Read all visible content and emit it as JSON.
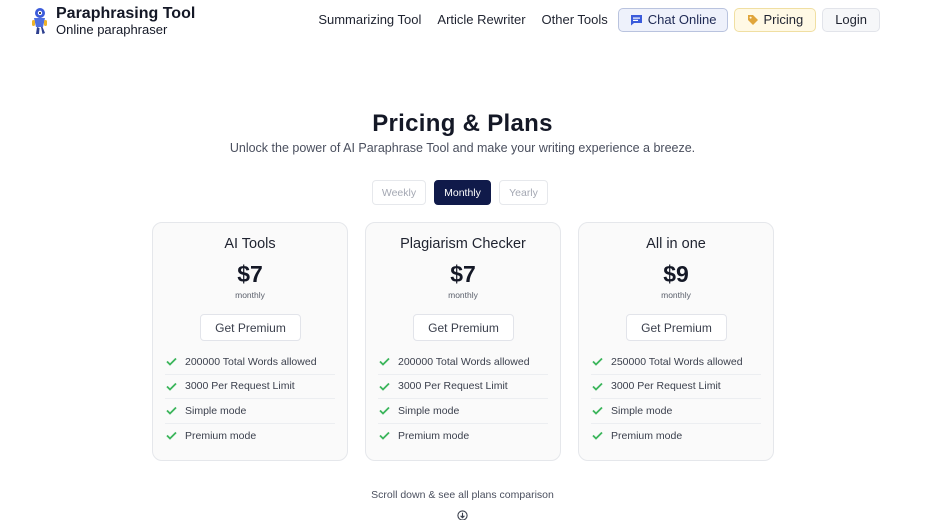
{
  "brand": {
    "title": "Paraphrasing Tool",
    "subtitle": "Online paraphraser",
    "logo_icon": "robot-mascot-icon"
  },
  "nav": {
    "links": [
      "Summarizing Tool",
      "Article Rewriter",
      "Other Tools"
    ],
    "chat_label": "Chat Online",
    "chat_icon": "chat-bubble-icon",
    "pricing_label": "Pricing",
    "pricing_icon": "price-tag-icon",
    "login_label": "Login"
  },
  "hero": {
    "title": "Pricing & Plans",
    "subtitle": "Unlock the power of AI Paraphrase Tool and make your writing experience a breeze."
  },
  "periods": {
    "options": [
      "Weekly",
      "Monthly",
      "Yearly"
    ],
    "selected": "Monthly"
  },
  "plans": [
    {
      "name": "AI Tools",
      "price": "$7",
      "period": "monthly",
      "cta": "Get Premium",
      "features": [
        "200000 Total Words allowed",
        "3000 Per Request Limit",
        "Simple mode",
        "Premium mode"
      ]
    },
    {
      "name": "Plagiarism Checker",
      "price": "$7",
      "period": "monthly",
      "cta": "Get Premium",
      "features": [
        "200000 Total Words allowed",
        "3000 Per Request Limit",
        "Simple mode",
        "Premium mode"
      ]
    },
    {
      "name": "All in one",
      "price": "$9",
      "period": "monthly",
      "cta": "Get Premium",
      "features": [
        "250000 Total Words allowed",
        "3000 Per Request Limit",
        "Simple mode",
        "Premium mode"
      ]
    }
  ],
  "footer": {
    "scroll_hint": "Scroll down & see all plans comparison",
    "scroll_icon": "scroll-down-icon"
  },
  "colors": {
    "accent_dark": "#101a4a",
    "check_green": "#3bb55b",
    "chat_blue": "#3b5bdb",
    "pricing_tag": "#e0a53a"
  }
}
